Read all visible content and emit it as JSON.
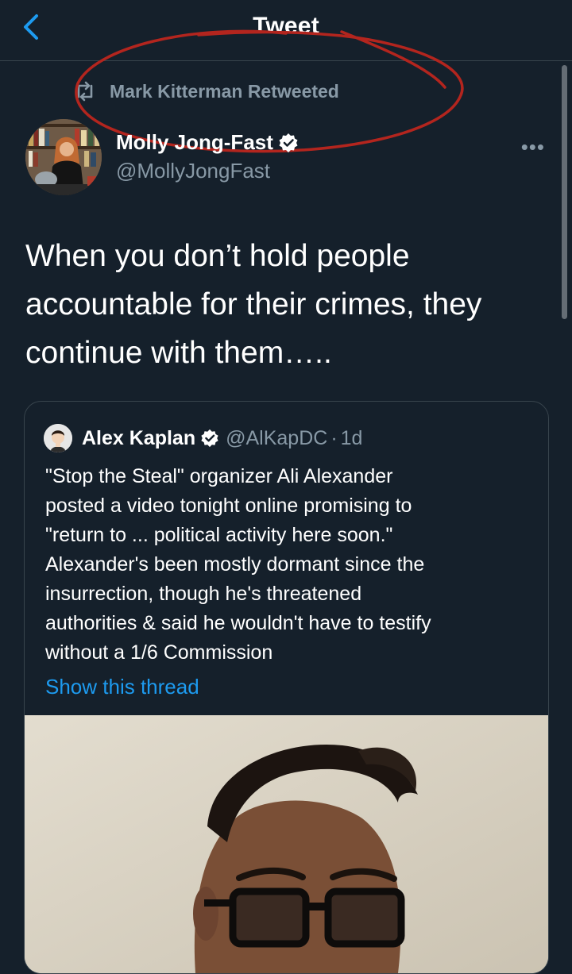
{
  "header": {
    "title": "Tweet"
  },
  "retweet": {
    "label": "Mark Kitterman Retweeted"
  },
  "tweet": {
    "author_name": "Molly Jong-Fast",
    "author_handle": "@MollyJongFast",
    "text": "When you don’t hold people accountable for their crimes, they continue with them…..",
    "more_label": "•••"
  },
  "quote": {
    "author_name": "Alex Kaplan",
    "author_handle": "@AlKapDC",
    "separator": "·",
    "age": "1d",
    "text": "\"Stop the Steal\" organizer Ali Alexander\nposted a video tonight online promising to\n\"return to ... political activity here soon.\"\nAlexander's been mostly dormant since the\ninsurrection, though he's threatened\nauthorities & said he wouldn't have to testify\nwithout a 1/6 Commission",
    "show_thread": "Show this thread"
  },
  "colors": {
    "background": "#15202b",
    "accent": "#1d9bf0",
    "muted": "#8899a6",
    "annotation": "#b3251e"
  },
  "icons": [
    "back-chevron-icon",
    "retweet-icon",
    "verified-badge-icon",
    "more-icon"
  ]
}
